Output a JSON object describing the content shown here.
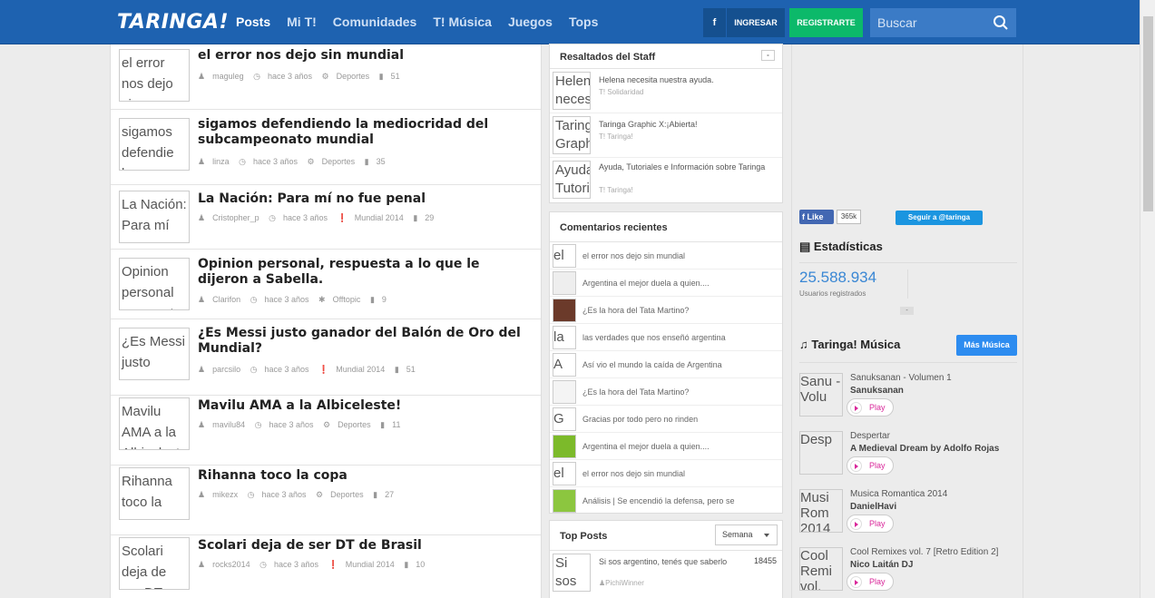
{
  "nav": {
    "logo": "TARINGA!",
    "links": [
      "Posts",
      "Mi T!",
      "Comunidades",
      "T! Música",
      "Juegos",
      "Tops"
    ],
    "fb_label": "f",
    "login_label": "INGRESAR",
    "register_label": "REGISTRARTE",
    "search_placeholder": "Buscar"
  },
  "posts": [
    {
      "thumb": "el error nos dejo sin",
      "title": "el error nos dejo sin mundial",
      "user": "maguleg",
      "time": "hace 3 años",
      "category": "Deportes",
      "comments": "51"
    },
    {
      "thumb": "sigamos defendie lo",
      "title": "sigamos defendiendo la mediocridad del subcampeonato mundial",
      "user": "linza",
      "time": "hace 3 años",
      "category": "Deportes",
      "comments": "35"
    },
    {
      "thumb": "La Nación: Para mí",
      "title": "La Nación: Para mí no fue penal",
      "user": "Cristopher_p",
      "time": "hace 3 años",
      "category": "Mundial 2014",
      "comments": "29"
    },
    {
      "thumb": "Opinion personal respuesta",
      "title": "Opinion personal, respuesta a lo que le dijeron a Sabella.",
      "user": "Clarifon",
      "time": "hace 3 años",
      "category": "Offtopic",
      "comments": "9"
    },
    {
      "thumb": "¿Es Messi justo",
      "title": "¿Es Messi justo ganador del Balón de Oro del Mundial?",
      "user": "parcsilo",
      "time": "hace 3 años",
      "category": "Mundial 2014",
      "comments": "51"
    },
    {
      "thumb": "Mavilu AMA a la Albiceleste",
      "title": "Mavilu AMA a la Albiceleste!",
      "user": "mavilu84",
      "time": "hace 3 años",
      "category": "Deportes",
      "comments": "11"
    },
    {
      "thumb": "Rihanna toco la copa",
      "title": "Rihanna toco la copa",
      "user": "mikezx",
      "time": "hace 3 años",
      "category": "Deportes",
      "comments": "27"
    },
    {
      "thumb": "Scolari deja de ser DT",
      "title": "Scolari deja de ser DT de Brasil",
      "user": "rocks2014",
      "time": "hace 3 años",
      "category": "Mundial 2014",
      "comments": "10"
    }
  ],
  "staff": {
    "header": "Resaltados del Staff",
    "toggle": "-",
    "items": [
      {
        "thumb": "Helena neces",
        "title": "Helena necesita nuestra ayuda.",
        "category": "Solidaridad"
      },
      {
        "thumb": "Taringa Graph",
        "title": "Taringa Graphic X:¡Abierta!",
        "category": "Taringa!"
      },
      {
        "thumb": "Ayuda Tutori",
        "title": "Ayuda, Tutoriales e Información sobre Taringa",
        "category": "Taringa!"
      }
    ]
  },
  "comments": {
    "header": "Comentarios recientes",
    "items": [
      {
        "av": "el",
        "text": "el error nos dejo sin mundial"
      },
      {
        "av": "",
        "text": "Argentina el mejor duela a quien...."
      },
      {
        "av": "",
        "text": "¿Es la hora del Tata Martino?"
      },
      {
        "av": "la",
        "text": "las verdades que nos enseñó argentina"
      },
      {
        "av": "A",
        "text": "Así vio el mundo la caída de Argentina"
      },
      {
        "av": "",
        "text": "¿Es la hora del Tata Martino?"
      },
      {
        "av": "G",
        "text": "Gracias por todo pero no rinden"
      },
      {
        "av": "",
        "text": "Argentina el mejor duela a quien...."
      },
      {
        "av": "el",
        "text": "el error nos dejo sin mundial"
      },
      {
        "av": "",
        "text": "Análisis | Se encendió la defensa, pero se"
      }
    ]
  },
  "top_posts": {
    "header": "Top Posts",
    "period": "Semana",
    "items": [
      {
        "thumb": "Si sos",
        "title": "Si sos argentino, tenés que saberlo",
        "user": "PichiWinner",
        "score": "18455"
      }
    ]
  },
  "social": {
    "like_label": "Like",
    "like_count": "365k",
    "twitter_label": "Seguir a @taringa"
  },
  "stats": {
    "title": "Estadísticas",
    "value": "25.588.934",
    "label": "Usuarios registrados",
    "toggle": "-"
  },
  "music": {
    "title": "Taringa! Música",
    "more_label": "Más Música",
    "play_label": "Play",
    "tracks": [
      {
        "thumb": "Sanu - Volu",
        "title": "Sanuksanan - Volumen 1",
        "artist": "Sanuksanan"
      },
      {
        "thumb": "Desp",
        "title": "Despertar",
        "artist": "A Medieval Dream by Adolfo Rojas"
      },
      {
        "thumb": "Musi Rom 2014",
        "title": "Musica Romantica 2014",
        "artist": "DanielHavi"
      },
      {
        "thumb": "Cool Remi vol.",
        "title": "Cool Remixes vol. 7 [Retro Edition 2]",
        "artist": "Nico Laitán DJ"
      }
    ]
  },
  "colors": {
    "nav_bg": "#1e62b0",
    "register_green": "#0cb96a",
    "stats_blue": "#3a87d4",
    "play_pink": "#d9279a"
  }
}
